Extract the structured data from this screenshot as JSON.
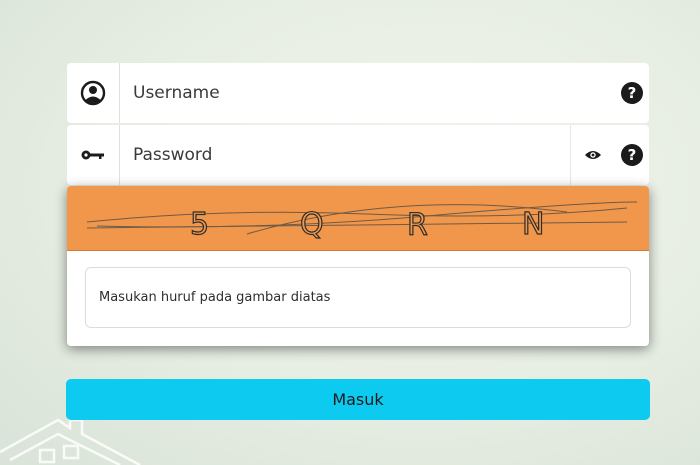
{
  "login": {
    "username_placeholder": "Username",
    "password_placeholder": "Password",
    "help_glyph": "?",
    "captcha_text": "5 Q R N",
    "captcha_placeholder": "Masukan huruf pada gambar diatas",
    "submit_label": "Masuk"
  },
  "icons": {
    "username": "user-circle-icon",
    "password": "key-icon",
    "toggle": "eye-icon",
    "help": "question-circle-icon"
  },
  "colors": {
    "captcha_bg": "#f0974c",
    "submit_bg": "#0dcbf0"
  }
}
